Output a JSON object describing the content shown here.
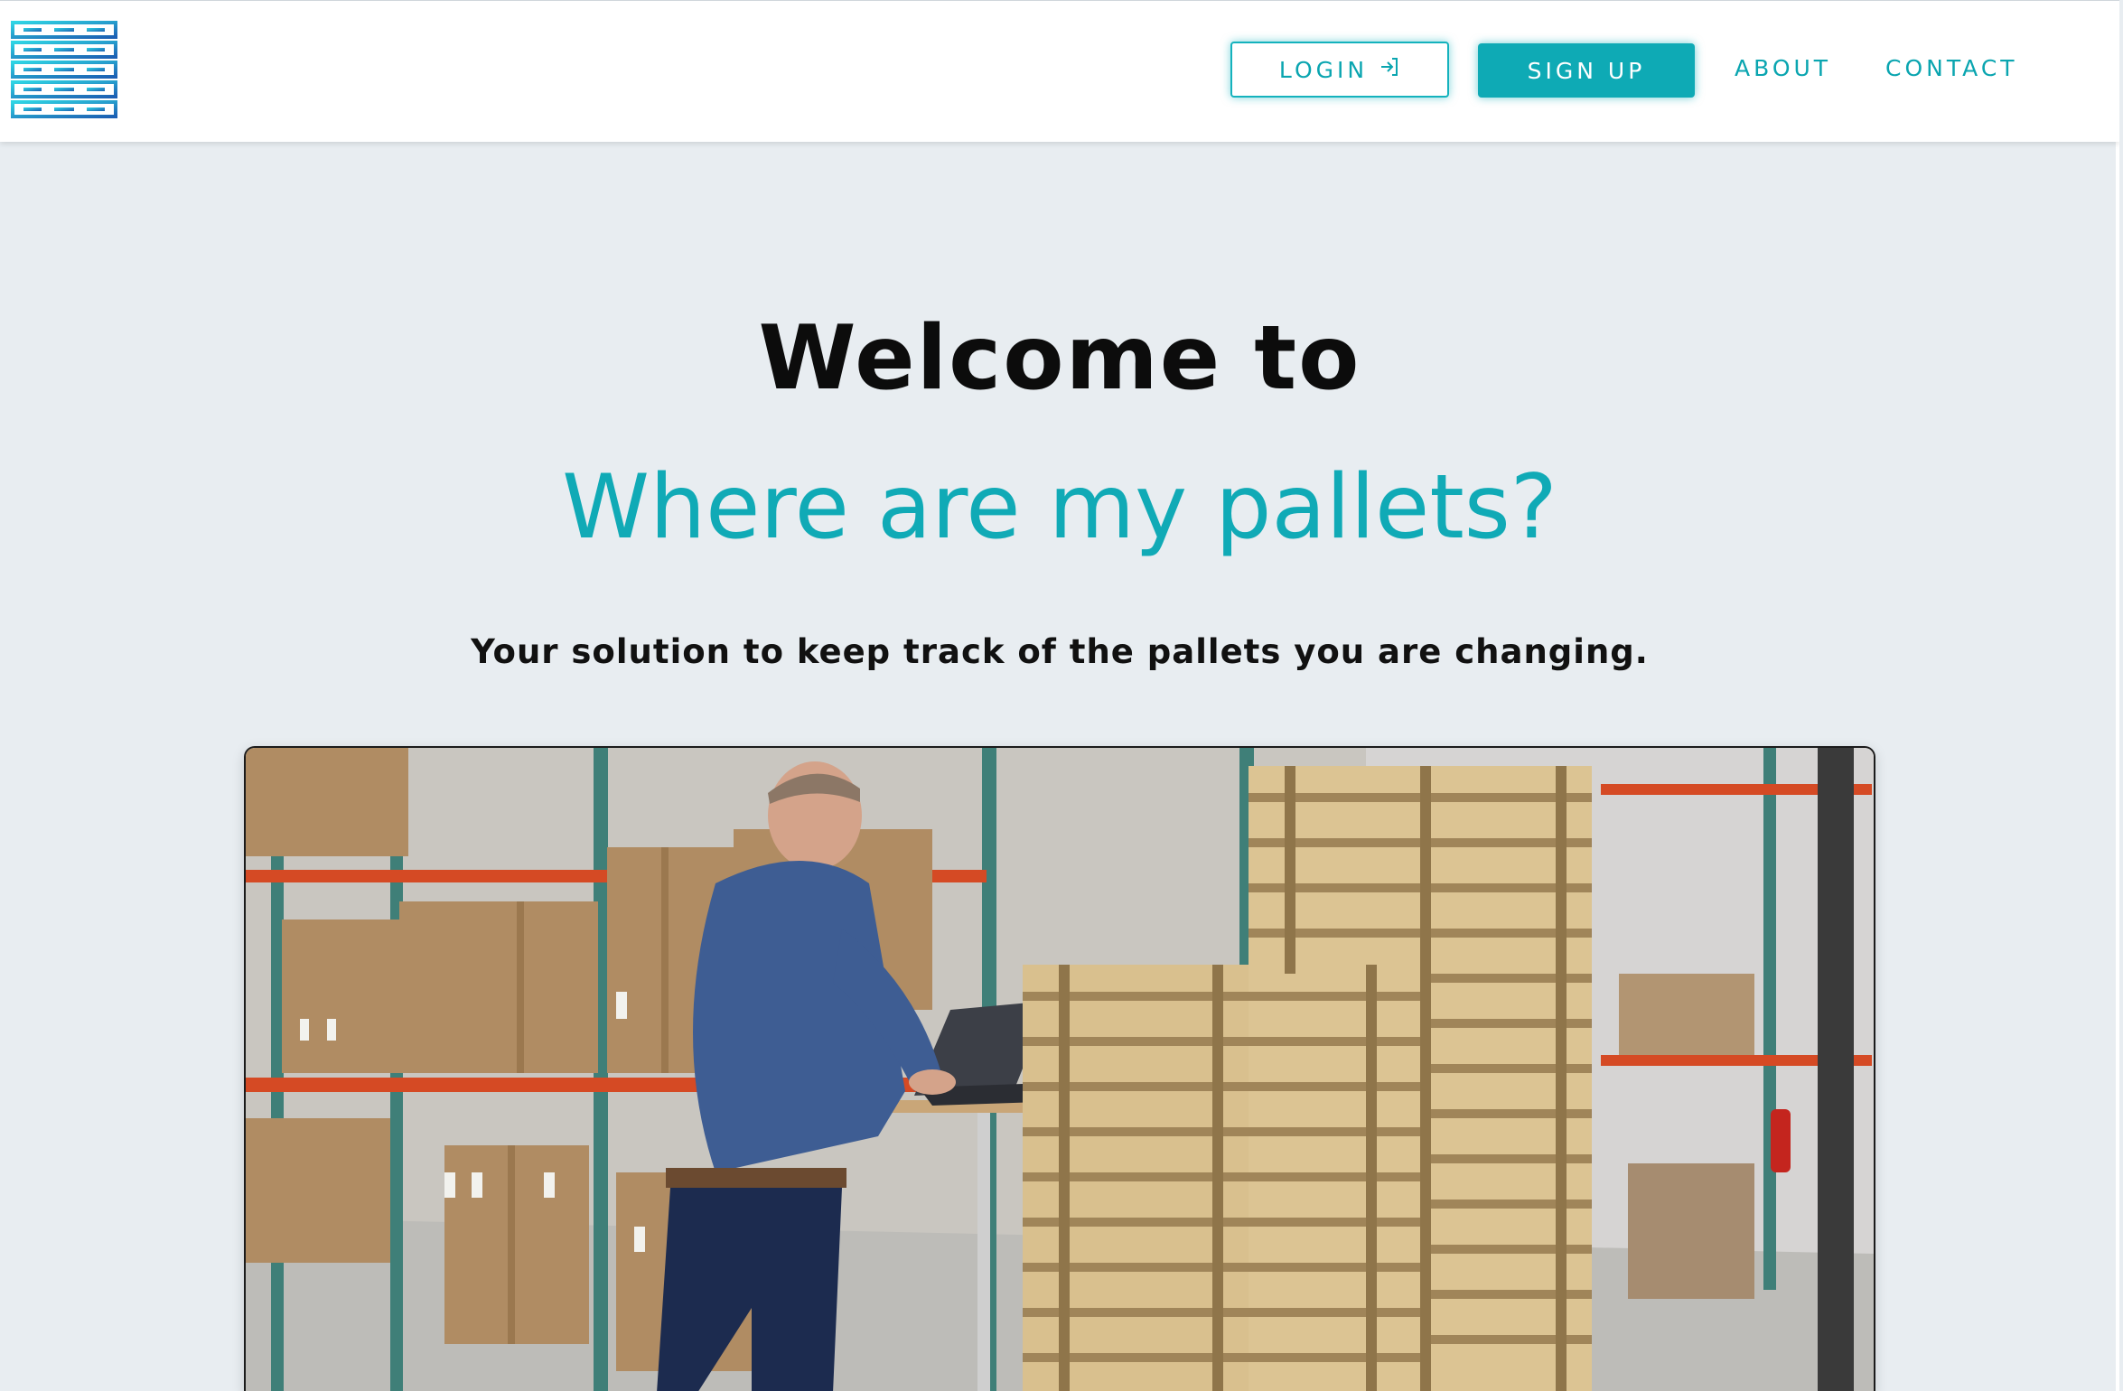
{
  "navbar": {
    "login_label": "LOGIN",
    "signup_label": "SIGN UP",
    "about_label": "ABOUT",
    "contact_label": "CONTACT",
    "login_icon": "login-arrow-icon",
    "logo_icon": "pallet-stack-logo"
  },
  "hero": {
    "line1": "Welcome to",
    "line2": "Where are my pallets?",
    "tagline": "Your solution to keep track of the pallets you are changing."
  },
  "photo": {
    "subject": "warehouse-worker-with-laptop-and-pallet-stacks"
  },
  "colors": {
    "accent": "#0eaab5",
    "background": "#e8edf1",
    "heading": "#0c0c0c"
  }
}
